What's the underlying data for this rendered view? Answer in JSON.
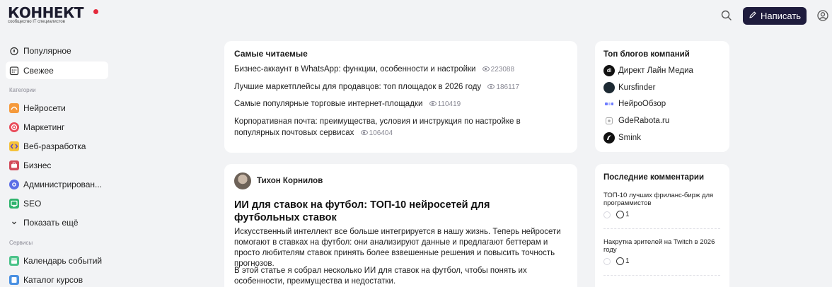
{
  "header": {
    "logo_text": "КОННЕКТ",
    "logo_subtitle": "сообщество IT специалистов",
    "write_label": "Написать",
    "accent_color": "#1f1c3d",
    "logo_dot_color": "#e4293b"
  },
  "sidebar": {
    "top_items": [
      {
        "label": "Популярное",
        "icon": "fire-icon"
      },
      {
        "label": "Свежее",
        "icon": "calendar-icon",
        "active": true
      }
    ],
    "categories_label": "Категории",
    "categories": [
      {
        "label": "Нейросети",
        "icon": "neural-icon"
      },
      {
        "label": "Маркетинг",
        "icon": "target-icon"
      },
      {
        "label": "Веб-разработка",
        "icon": "code-icon"
      },
      {
        "label": "Бизнес",
        "icon": "briefcase-icon"
      },
      {
        "label": "Администрирован...",
        "icon": "gear-icon"
      },
      {
        "label": "SEO",
        "icon": "seo-icon"
      }
    ],
    "show_more_label": "Показать ещё",
    "services_label": "Сервисы",
    "services": [
      {
        "label": "Календарь событий",
        "icon": "calendar-events-icon"
      },
      {
        "label": "Каталог курсов",
        "icon": "courses-icon"
      }
    ]
  },
  "most_read": {
    "title": "Самые читаемые",
    "items": [
      {
        "title": "Бизнес-аккаунт в WhatsApp: функции, особенности и настройки",
        "views": "223088"
      },
      {
        "title": "Лучшие маркетплейсы для продавцов: топ площадок в 2026 году",
        "views": "186117"
      },
      {
        "title": "Самые популярные торговые интернет-площадки",
        "views": "110419"
      },
      {
        "title": "Корпоративная почта: преимущества, условия и инструкция по настройке в популярных почтовых сервисах",
        "views": "106404"
      }
    ]
  },
  "article": {
    "author": "Тихон Корнилов",
    "title": "ИИ для ставок на футбол: ТОП-10 нейросетей для футбольных ставок",
    "paragraphs": [
      "Искусственный интеллект все больше интегрируется в нашу жизнь. Теперь нейросети помогают в ставках на футбол: они анализируют данные и предлагают беттерам и просто любителям ставок принять более взвешенные решения и повысить точность прогнозов.",
      "В этой статье я собрал несколько ИИ для ставок на футбол, чтобы понять их особенности, преимущества и недостатки."
    ]
  },
  "top_blogs": {
    "title": "Топ блогов компаний",
    "items": [
      {
        "name": "Директ Лайн Медиа",
        "logo": "dl",
        "color": "#111111"
      },
      {
        "name": "Kursfinder",
        "logo": "",
        "color": "#1d2a33"
      },
      {
        "name": "НейроОбзор",
        "logo": "",
        "color": "#6d7cff"
      },
      {
        "name": "GdeRabota.ru",
        "logo": "",
        "color": "#bbbbbb"
      },
      {
        "name": "Smink",
        "logo": "",
        "color": "#111111"
      }
    ]
  },
  "comments": {
    "title": "Последние комментарии",
    "items": [
      {
        "title": "ТОП-10 лучших фриланс-бирж для программистов",
        "count": "1"
      },
      {
        "title": "Накрутка зрителей на Twitch в 2026 году",
        "count": "1"
      }
    ]
  }
}
